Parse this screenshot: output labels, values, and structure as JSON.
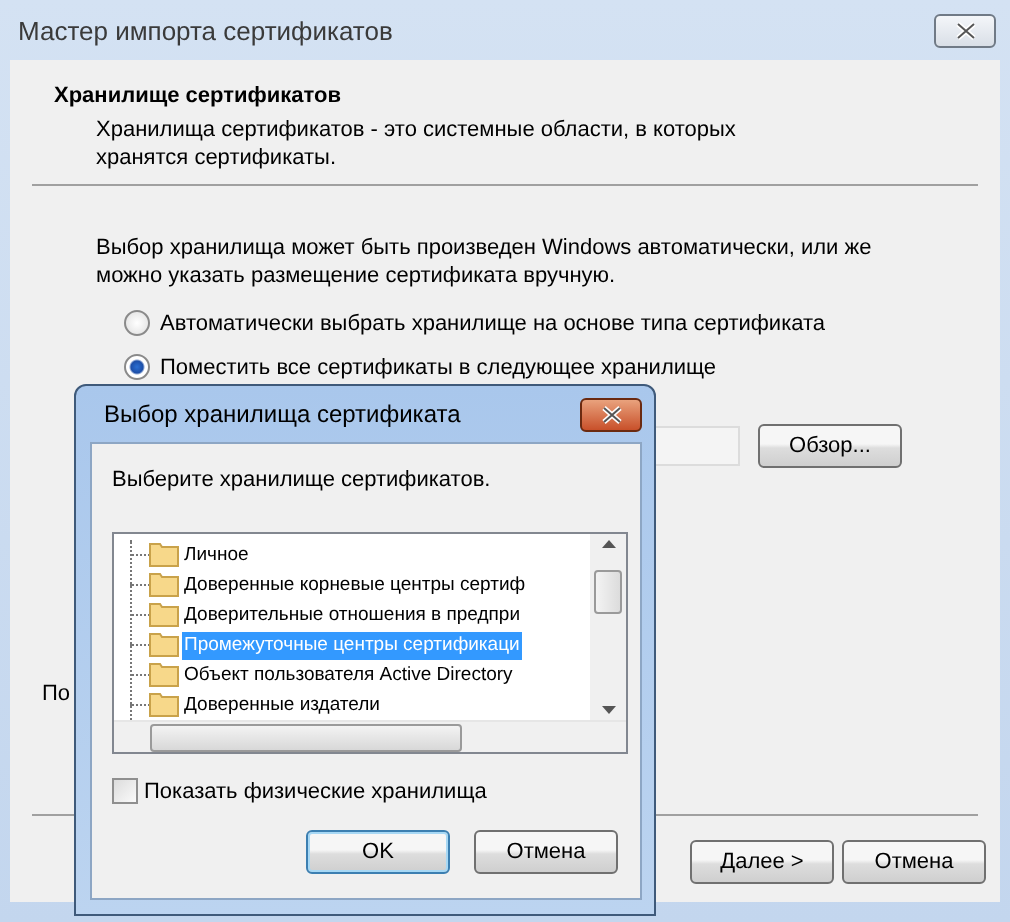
{
  "window": {
    "title": "Мастер импорта сертификатов"
  },
  "header": {
    "title": "Хранилище сертификатов",
    "description": "Хранилища сертификатов - это системные области, в которых хранятся сертификаты."
  },
  "intro": "Выбор хранилища может быть произведен Windows автоматически, или же можно указать размещение сертификата вручную.",
  "options": [
    {
      "label": "Автоматически выбрать хранилище на основе типа сертификата",
      "selected": false
    },
    {
      "label": "Поместить все сертификаты в следующее хранилище",
      "selected": true
    }
  ],
  "browse_button": "Обзор...",
  "partial_label": "По",
  "buttons": [
    "Далее >",
    "Отмена"
  ],
  "dialog": {
    "title": "Выбор хранилища сертификата",
    "prompt": "Выберите хранилище сертификатов.",
    "stores": [
      {
        "label": "Личное",
        "selected": false
      },
      {
        "label": "Доверенные корневые центры сертиф",
        "selected": false
      },
      {
        "label": "Доверительные отношения в предпри",
        "selected": false
      },
      {
        "label": "Промежуточные центры сертификаци",
        "selected": true
      },
      {
        "label": "Объект пользователя Active Directory",
        "selected": false
      },
      {
        "label": "Доверенные издатели",
        "selected": false
      }
    ],
    "show_physical": {
      "label": "Показать физические хранилища",
      "checked": false
    },
    "buttons": [
      "OK",
      "Отмена"
    ]
  }
}
